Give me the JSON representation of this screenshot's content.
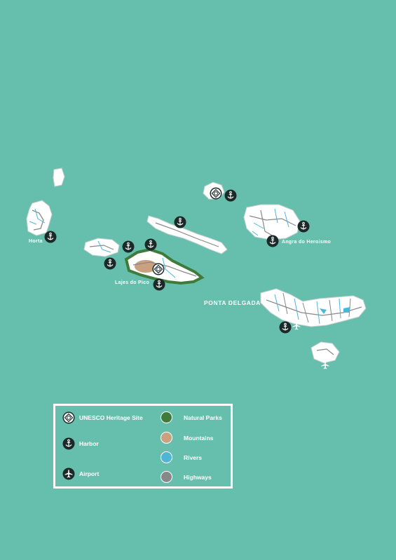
{
  "map_labels": {
    "horta": "Horta",
    "lajes_do_pico": "Lajes do Pico",
    "angra_do_heroismo": "Angra do Heroismo",
    "ponta_delgada": "PONTA DELGADA"
  },
  "legend": {
    "unesco": "UNESCO Heritage Site",
    "harbor": "Harbor",
    "airport": "Airport",
    "natural_parks": "Natural Parks",
    "mountains": "Mountains",
    "rivers": "Rivers",
    "highways": "Highways"
  },
  "colors": {
    "sea": "#66bfad",
    "land": "#ffffff",
    "natural_parks": "#3f7b3a",
    "mountains": "#c9a17f",
    "rivers": "#4bb6d6",
    "highways": "#888888",
    "marker": "#1b2a29"
  },
  "icons": [
    "unesco-icon",
    "anchor-icon",
    "airplane-icon"
  ]
}
